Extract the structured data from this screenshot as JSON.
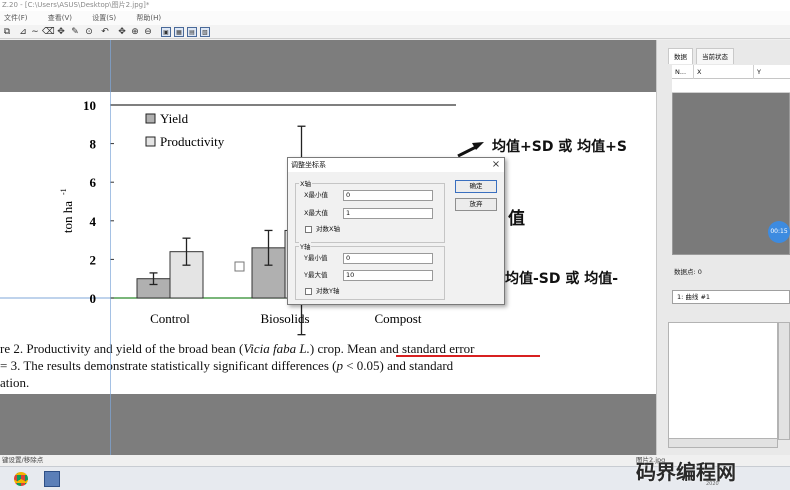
{
  "window": {
    "title": "Z.20 - [C:\\Users\\ASUS\\Desktop\\图片2.jpg]*"
  },
  "menu": [
    "文件(F)",
    "查看(V)",
    "设置(S)",
    "帮助(H)"
  ],
  "toolbar_icons": [
    "copy-icon",
    "select-icon",
    "curve-icon",
    "eraser-icon",
    "move-icon",
    "pencil-icon",
    "undo-icon",
    "pan-icon",
    "zoom-in-icon",
    "zoom-out-icon",
    "fit-icon",
    "grid-icon",
    "grid2-icon",
    "grid3-icon"
  ],
  "figure": {
    "legend": [
      {
        "label": "Yield",
        "fill": "#b0b0b0"
      },
      {
        "label": "Productivity",
        "fill": "#e4e4e4"
      }
    ],
    "yaxis_label": "ton ha",
    "yaxis_sup": "-1",
    "caption_line1_a": "re 2.  Productivity and yield of the broad bean (",
    "caption_line1_italic": "Vicia faba L.",
    "caption_line1_b": ") crop. ",
    "caption_line1_underlined": "Mean and standard error",
    "caption_line2_a": " = 3.  The results demonstrate statistically significant differences (",
    "caption_line2_italic": "p",
    "caption_line2_b": " < 0.05) and standard",
    "caption_line3": "ation."
  },
  "overlay_text": {
    "top_right": "均值+SD    或    均值+S",
    "middle": "值",
    "bottom_right": "均值-SD    或    均值-"
  },
  "chart_data": {
    "type": "bar",
    "categories": [
      "Control",
      "Biosolids",
      "Compost"
    ],
    "series": [
      {
        "name": "Yield",
        "values": [
          1.0,
          2.6,
          null
        ],
        "errors": [
          0.3,
          0.9,
          null
        ]
      },
      {
        "name": "Productivity",
        "values": [
          2.4,
          3.5,
          null
        ],
        "errors": [
          0.7,
          5.4,
          null
        ]
      }
    ],
    "ylim": [
      0,
      10
    ],
    "yticks": [
      "0",
      "2",
      "4",
      "6",
      "8",
      "10"
    ],
    "ylabel": "ton ha-1",
    "legend_position": "top-left"
  },
  "dialog": {
    "title": "调整坐标系",
    "close": "×",
    "x_group": "X轴",
    "x_min_label": "X最小值",
    "x_min_value": "0",
    "x_max_label": "X最大值",
    "x_max_value": "1",
    "x_log_label": "对数X轴",
    "y_group": "Y轴",
    "y_min_label": "Y最小值",
    "y_min_value": "0",
    "y_max_label": "Y最大值",
    "y_max_value": "10",
    "y_log_label": "对数Y轴",
    "ok_label": "确定",
    "cancel_label": "放弃"
  },
  "right_panel": {
    "tabs": [
      "数据",
      "当前状态"
    ],
    "columns": [
      "N...",
      "X",
      "Y"
    ],
    "data_points_label": "数据点: 0",
    "curve_label": "1: 曲线 #1",
    "time_badge": "00:15"
  },
  "status": {
    "left": "键设置/移除点",
    "right": "图片2.jpg"
  },
  "watermark": {
    "text": "码界编程网",
    "sub": "2020"
  }
}
